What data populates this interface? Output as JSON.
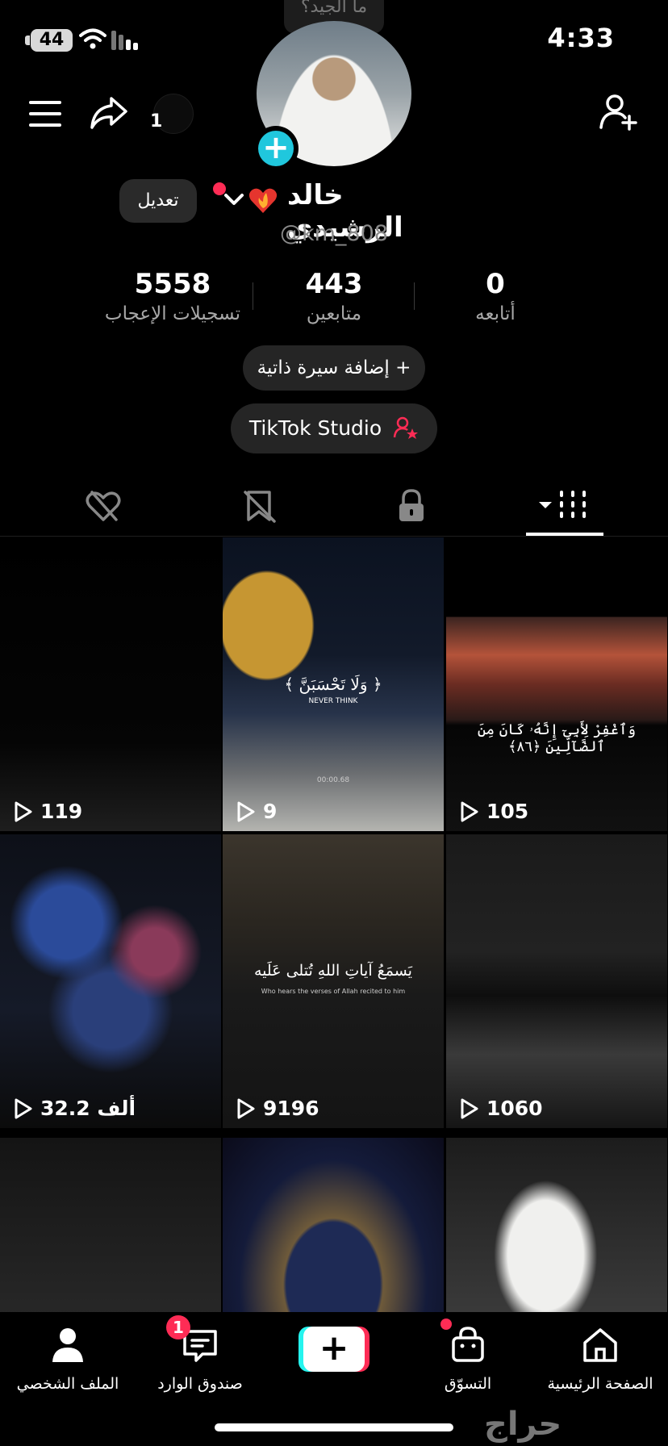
{
  "status_bar": {
    "battery": "44",
    "time": "4:33"
  },
  "top_nav": {
    "share_count": "1",
    "tooltip": "ما الجيد؟"
  },
  "profile": {
    "display_name": "خالد الرشيدي",
    "username": "@km_808",
    "edit_label": "تعديل"
  },
  "stats": {
    "following": {
      "value": "0",
      "label": "أتابعه"
    },
    "followers": {
      "value": "443",
      "label": "متابعين"
    },
    "likes": {
      "value": "5558",
      "label": "تسجيلات الإعجاب"
    }
  },
  "actions": {
    "add_bio": "+ إضافة سيرة ذاتية",
    "studio": "TikTok Studio"
  },
  "videos": [
    {
      "views": "105",
      "caption": "وَٱغْفِرْ لِأَبِىٓ إِنَّهُۥ كَانَ مِنَ ٱلضَّآلِّينَ ﴿٨٦﴾"
    },
    {
      "views": "9",
      "caption": "﴿ وَلَا تَحْسَبَنَّ ﴾",
      "caption_en": "NEVER THINK",
      "timestamp": "00:00.68"
    },
    {
      "views": "119"
    },
    {
      "views": "1060"
    },
    {
      "views": "9196",
      "caption": "يَسمَعُ آياتِ اللهِ تُتلى عَلَيه",
      "caption_en": "Who hears the verses of Allah recited to him"
    },
    {
      "views": "32.2 ألف"
    },
    {
      "views": ""
    },
    {
      "views": ""
    },
    {
      "views": ""
    }
  ],
  "bottom_nav": {
    "home": "الصفحة الرئيسية",
    "shop": "التسوّق",
    "inbox": "صندوق الوارد",
    "inbox_badge": "1",
    "profile": "الملف الشخصي"
  },
  "watermark": "حراج",
  "colors": {
    "accent": "#fe2c55",
    "cyan": "#25f4ee",
    "avatar_plus": "#20c7dd"
  }
}
